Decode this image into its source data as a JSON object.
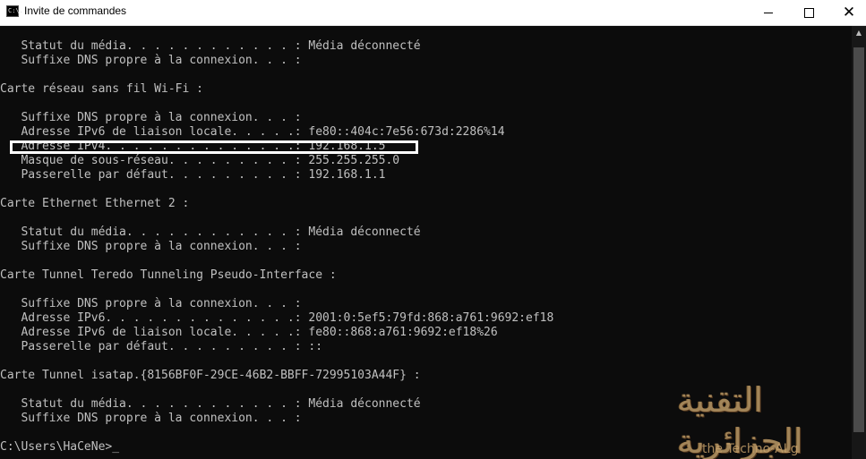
{
  "window": {
    "title": "Invite de commandes",
    "icon": "cmd-icon",
    "icon_text": "C:\\.",
    "controls": [
      {
        "name": "minimize",
        "glyph": "—"
      },
      {
        "name": "maximize",
        "glyph": "□"
      },
      {
        "name": "close",
        "glyph": "✕"
      }
    ]
  },
  "console": {
    "lines": [
      "   Statut du média. . . . . . . . . . . . : Média déconnecté",
      "   Suffixe DNS propre à la connexion. . . :",
      "",
      "Carte réseau sans fil Wi-Fi :",
      "",
      "   Suffixe DNS propre à la connexion. . . :",
      "   Adresse IPv6 de liaison locale. . . . .: fe80::404c:7e56:673d:2286%14",
      "   Adresse IPv4. . . . . . . . . . . . . .: 192.168.1.5",
      "   Masque de sous-réseau. . . . . . . . . : 255.255.255.0",
      "   Passerelle par défaut. . . . . . . . . : 192.168.1.1",
      "",
      "Carte Ethernet Ethernet 2 :",
      "",
      "   Statut du média. . . . . . . . . . . . : Média déconnecté",
      "   Suffixe DNS propre à la connexion. . . :",
      "",
      "Carte Tunnel Teredo Tunneling Pseudo-Interface :",
      "",
      "   Suffixe DNS propre à la connexion. . . :",
      "   Adresse IPv6. . . . . . . . . . . . . .: 2001:0:5ef5:79fd:868:a761:9692:ef18",
      "   Adresse IPv6 de liaison locale. . . . .: fe80::868:a761:9692:ef18%26",
      "   Passerelle par défaut. . . . . . . . . : ::",
      "",
      "Carte Tunnel isatap.{8156BF0F-29CE-46B2-BBFF-72995103A44F} :",
      "",
      "   Statut du média. . . . . . . . . . . . : Média déconnecté",
      "   Suffixe DNS propre à la connexion. . . :",
      "",
      "C:\\Users\\HaCeNe>_"
    ]
  },
  "watermark": {
    "arabic": "التقنية الجزائرية",
    "latin": "the Techno-ALg"
  },
  "scrollbar": {
    "up_icon": "scroll-up-arrow-icon"
  }
}
